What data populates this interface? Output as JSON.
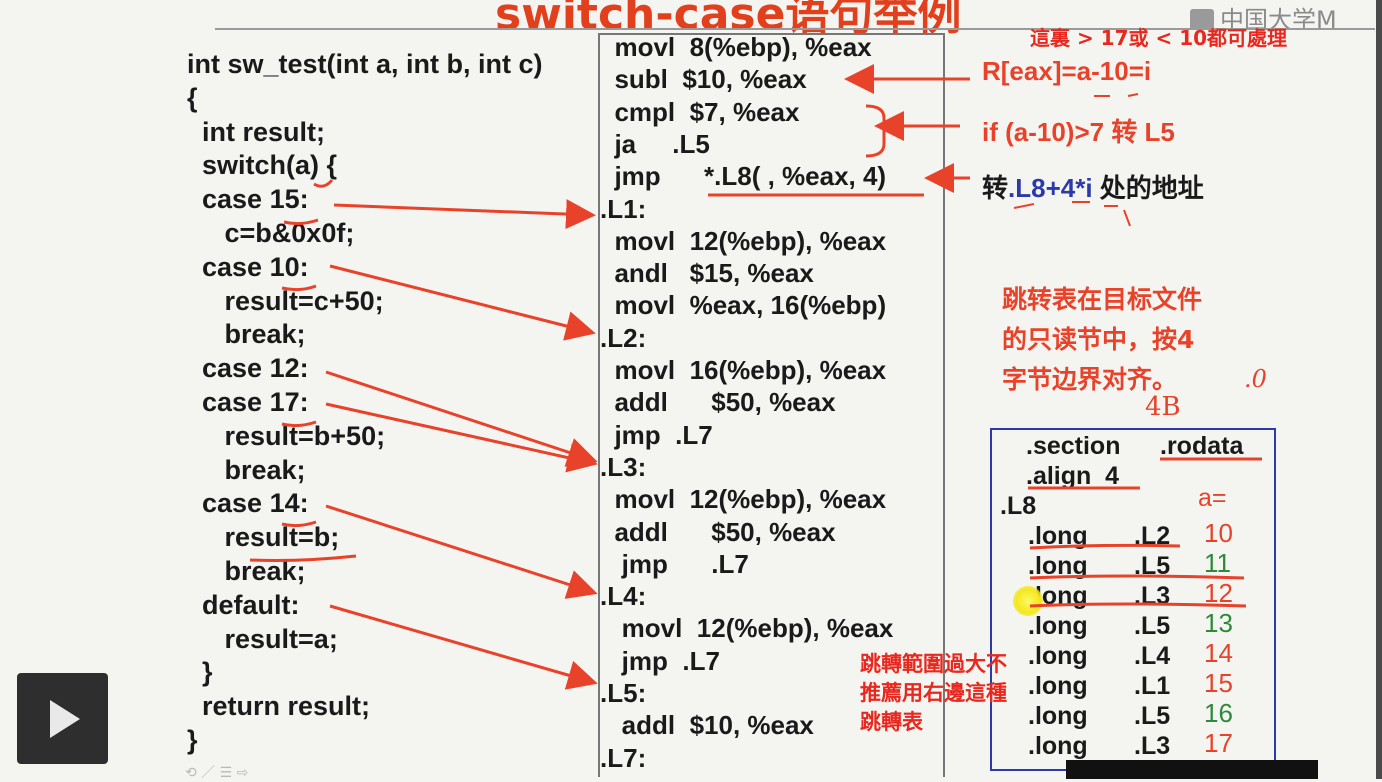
{
  "slide_title_fragment": "switch-case语句举例",
  "watermark_text": "中国大学M",
  "top_note": "這裏 > 17或 < 10都可處理",
  "c_code": [
    "int sw_test(int a, int b, int c)",
    "{",
    "  int result;",
    "  switch(a) {",
    "  case 15:",
    "     c=b&0x0f;",
    "  case 10:",
    "     result=c+50;",
    "     break;",
    "  case 12:",
    "  case 17:",
    "     result=b+50;",
    "     break;",
    "  case 14:",
    "     result=b;",
    "     break;",
    "  default:",
    "     result=a;",
    "  }",
    "  return result;",
    "}"
  ],
  "asm_code": [
    "  movl  8(%ebp), %eax",
    "  subl  $10, %eax",
    "  cmpl  $7, %eax",
    "  ja     .L5",
    "  jmp      *.L8( , %eax, 4)",
    ".L1:",
    "  movl  12(%ebp), %eax",
    "  andl   $15, %eax",
    "  movl  %eax, 16(%ebp)",
    ".L2:",
    "  movl  16(%ebp), %eax",
    "  addl      $50, %eax",
    "  jmp  .L7",
    ".L3:",
    "  movl  12(%ebp), %eax",
    "  addl      $50, %eax",
    "   jmp      .L7",
    ".L4:",
    "   movl  12(%ebp), %eax",
    "   jmp  .L7",
    ".L5:",
    "   addl  $10, %eax",
    ".L7:"
  ],
  "annotations": {
    "reax": "R[eax]=a-10=i",
    "ifjump": "if (a-10)>7 转 L5",
    "jumpaddr_prefix": "转",
    "jumpaddr_expr": ".L8+4*i",
    "jumpaddr_suffix": " 处的地址",
    "jumptable_note": "跳转表在目标文件\n的只读节中，按4\n字节边界对齐。",
    "hand_48": "4B",
    "hand_0": ".0",
    "bottom_note": "跳轉範圍過大不\n推薦用右邊這種\n跳轉表"
  },
  "rodata": {
    "section": ".section",
    "section_name": ".rodata",
    "align": ".align  4",
    "label": ".L8",
    "a_header": "a=",
    "entries": [
      {
        "dir": ".long",
        "target": ".L2",
        "a": "10",
        "color": "#e8432a"
      },
      {
        "dir": ".long",
        "target": ".L5",
        "a": "11",
        "color": "#2e8a3a"
      },
      {
        "dir": ".long",
        "target": ".L3",
        "a": "12",
        "color": "#e8432a"
      },
      {
        "dir": ".long",
        "target": ".L5",
        "a": "13",
        "color": "#2e8a3a"
      },
      {
        "dir": ".long",
        "target": ".L4",
        "a": "14",
        "color": "#e8432a"
      },
      {
        "dir": ".long",
        "target": ".L1",
        "a": "15",
        "color": "#e8432a"
      },
      {
        "dir": ".long",
        "target": ".L5",
        "a": "16",
        "color": "#2e8a3a"
      },
      {
        "dir": ".long",
        "target": ".L3",
        "a": "17",
        "color": "#e8432a"
      }
    ]
  },
  "player": {
    "play_icon": "play-icon",
    "controls_text": "⟲ ／ ☰ ⇨"
  },
  "colors": {
    "accent": "#e8432a",
    "box_border": "#2b3aa8",
    "note_red": "#e8281e",
    "green": "#2e8a3a"
  }
}
